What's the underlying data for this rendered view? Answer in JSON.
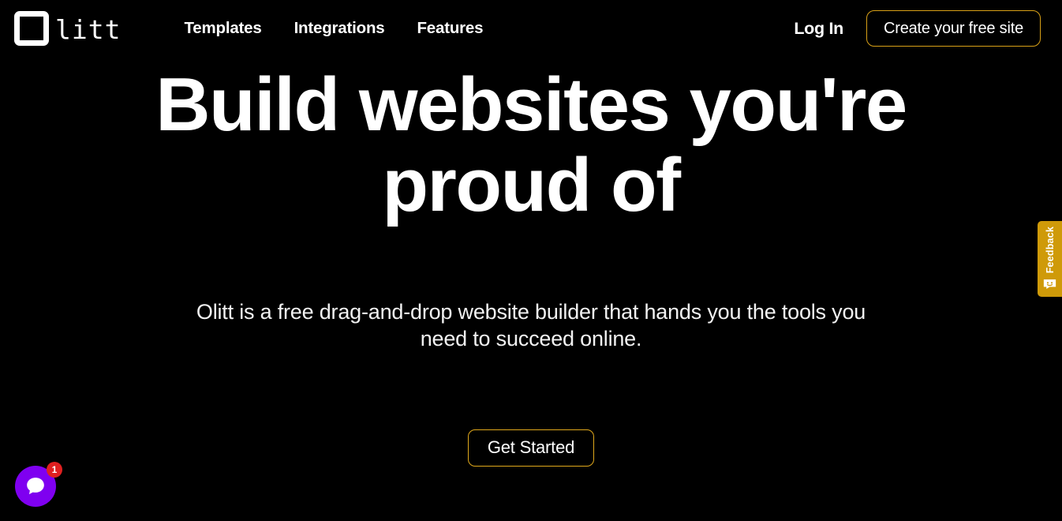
{
  "page": {
    "background_color": "#000000",
    "accent_gold": "#d8a017",
    "chat_purple": "#7f00f0",
    "badge_red": "#e02020"
  },
  "header": {
    "brand": {
      "logo_icon": "square-outline-icon",
      "wordmark": "litt"
    },
    "nav": [
      {
        "label": "Templates"
      },
      {
        "label": "Integrations"
      },
      {
        "label": "Features"
      }
    ],
    "login_label": "Log In",
    "cta_label": "Create your free site"
  },
  "hero": {
    "title": "Build websites you're proud of",
    "subtitle": "Olitt is a free drag-and-drop website builder that hands you the tools you need to succeed online.",
    "cta_label": "Get Started"
  },
  "feedback_tab": {
    "label": "Feedback",
    "icon": "smiley-message-icon"
  },
  "chat_widget": {
    "icon": "chat-bubble-icon",
    "badge_count": "1"
  }
}
